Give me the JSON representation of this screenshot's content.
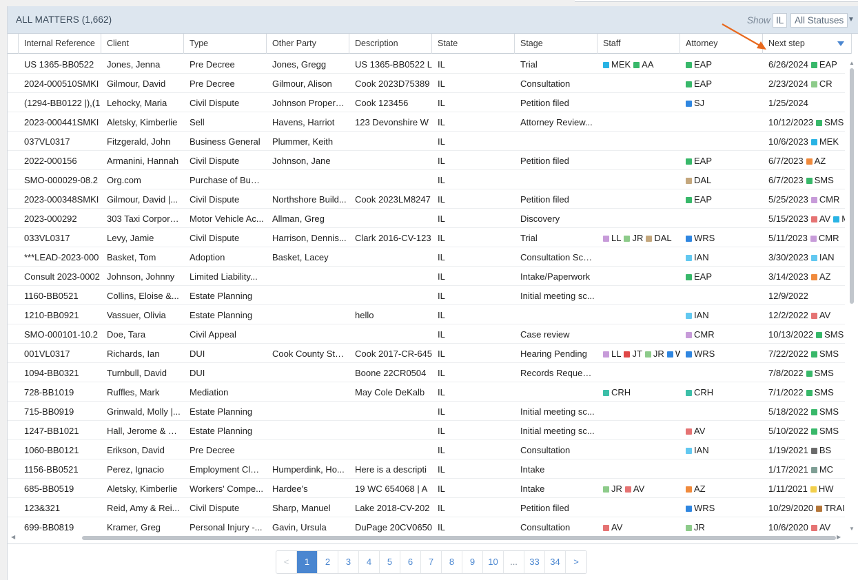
{
  "header": {
    "title": "ALL MATTERS (1,662)",
    "show_label": "Show",
    "state_filter": "IL",
    "status_filter": "All Statuses"
  },
  "columns": [
    "Internal Reference",
    "Client",
    "Type",
    "Other Party",
    "Description",
    "State",
    "Stage",
    "Staff",
    "Attorney",
    "Next step"
  ],
  "colors": {
    "accent": "#4a86d0",
    "annotation_arrow": "#e8691e"
  },
  "tag_colors": {
    "MEK": "#29b3e4",
    "AA": "#38b86a",
    "EAP": "#38b86a",
    "CR": "#8dcb8a",
    "SJ": "#2f86e0",
    "SMS": "#38b86a",
    "AZ": "#f08a3c",
    "DAL": "#c4a77d",
    "CMR": "#c79bd9",
    "AV": "#e57373",
    "LL": "#c79bd9",
    "JR": "#8dcb8a",
    "WRS": "#2f86e0",
    "IAN": "#62c8f0",
    "JT": "#e04848",
    "W": "#2f86e0",
    "CRH": "#3cbfa8",
    "BS": "#6b6b6b",
    "MC": "#7f9f95",
    "HW": "#f2cf4a",
    "TRAI": "#b5773a"
  },
  "rows": [
    {
      "ref": "US 1365-BB0522",
      "client": "Jones, Jenna",
      "type": "Pre Decree",
      "other": "Jones, Gregg",
      "desc": "US 1365-BB0522 L",
      "state": "IL",
      "stage": "Trial",
      "staff": [
        "MEK",
        "AA"
      ],
      "attorney": [
        "EAP"
      ],
      "next_date": "6/26/2024",
      "next_tag": [
        "EAP"
      ]
    },
    {
      "ref": "2024-000510SMKI",
      "client": "Gilmour, David",
      "type": "Pre Decree",
      "other": "Gilmour, Alison",
      "desc": "Cook 2023D75389",
      "state": "IL",
      "stage": "Consultation",
      "staff": [],
      "attorney": [
        "EAP"
      ],
      "next_date": "2/23/2024",
      "next_tag": [
        "CR"
      ]
    },
    {
      "ref": "(1294-BB0122 |),(1",
      "client": "Lehocky, Maria",
      "type": "Civil Dispute",
      "other": "Johnson Properti...",
      "desc": "Cook 123456",
      "state": "IL",
      "stage": "Petition filed",
      "staff": [],
      "attorney": [
        "SJ"
      ],
      "next_date": "1/25/2024",
      "next_tag": []
    },
    {
      "ref": "2023-000441SMKI",
      "client": "Aletsky, Kimberlie",
      "type": "Sell",
      "other": "Havens, Harriot",
      "desc": "123 Devonshire W",
      "state": "IL",
      "stage": "Attorney Review...",
      "staff": [],
      "attorney": [],
      "next_date": "10/12/2023",
      "next_tag": [
        "SMS"
      ]
    },
    {
      "ref": "037VL0317",
      "client": "Fitzgerald, John",
      "type": "Business General",
      "other": "Plummer, Keith",
      "desc": "",
      "state": "IL",
      "stage": "",
      "staff": [],
      "attorney": [],
      "next_date": "10/6/2023",
      "next_tag": [
        "MEK"
      ]
    },
    {
      "ref": "2022-000156",
      "client": "Armanini, Hannah",
      "type": "Civil Dispute",
      "other": "Johnson, Jane",
      "desc": "",
      "state": "IL",
      "stage": "Petition filed",
      "staff": [],
      "attorney": [
        "EAP"
      ],
      "next_date": "6/7/2023",
      "next_tag": [
        "AZ"
      ]
    },
    {
      "ref": "SMO-000029-08.2",
      "client": "Org.com",
      "type": "Purchase of Busi...",
      "other": "",
      "desc": "",
      "state": "IL",
      "stage": "",
      "staff": [],
      "attorney": [
        "DAL"
      ],
      "next_date": "6/7/2023",
      "next_tag": [
        "SMS"
      ]
    },
    {
      "ref": "2023-000348SMKI",
      "client": "Gilmour, David |...",
      "type": "Civil Dispute",
      "other": "Northshore Build...",
      "desc": "Cook 2023LM8247",
      "state": "IL",
      "stage": "Petition filed",
      "staff": [],
      "attorney": [
        "EAP"
      ],
      "next_date": "5/25/2023",
      "next_tag": [
        "CMR"
      ]
    },
    {
      "ref": "2023-000292",
      "client": "303 Taxi Corpora...",
      "type": "Motor Vehicle Ac...",
      "other": "Allman, Greg",
      "desc": "",
      "state": "IL",
      "stage": "Discovery",
      "staff": [],
      "attorney": [],
      "next_date": "5/15/2023",
      "next_tag": [
        "AV",
        "MEK"
      ]
    },
    {
      "ref": "033VL0317",
      "client": "Levy, Jamie",
      "type": "Civil Dispute",
      "other": "Harrison, Dennis...",
      "desc": "Clark 2016-CV-123",
      "state": "IL",
      "stage": "Trial",
      "staff": [
        "LL",
        "JR",
        "DAL"
      ],
      "attorney": [
        "WRS"
      ],
      "next_date": "5/11/2023",
      "next_tag": [
        "CMR"
      ]
    },
    {
      "ref": "***LEAD-2023-000",
      "client": "Basket, Tom",
      "type": "Adoption",
      "other": "Basket, Lacey",
      "desc": "",
      "state": "IL",
      "stage": "Consultation Sch...",
      "staff": [],
      "attorney": [
        "IAN"
      ],
      "next_date": "3/30/2023",
      "next_tag": [
        "IAN"
      ]
    },
    {
      "ref": "Consult 2023-0002",
      "client": "Johnson, Johnny",
      "type": "Limited Liability...",
      "other": "",
      "desc": "",
      "state": "IL",
      "stage": "Intake/Paperwork",
      "staff": [],
      "attorney": [
        "EAP"
      ],
      "next_date": "3/14/2023",
      "next_tag": [
        "AZ"
      ]
    },
    {
      "ref": "1160-BB0521",
      "client": "Collins, Eloise &...",
      "type": "Estate Planning",
      "other": "",
      "desc": "",
      "state": "IL",
      "stage": "Initial meeting sc...",
      "staff": [],
      "attorney": [],
      "next_date": "12/9/2022",
      "next_tag": []
    },
    {
      "ref": "1210-BB0921",
      "client": "Vassuer, Olivia",
      "type": "Estate Planning",
      "other": "",
      "desc": "hello",
      "state": "IL",
      "stage": "",
      "staff": [],
      "attorney": [
        "IAN"
      ],
      "next_date": "12/2/2022",
      "next_tag": [
        "AV"
      ]
    },
    {
      "ref": "SMO-000101-10.2",
      "client": "Doe, Tara",
      "type": "Civil Appeal",
      "other": "",
      "desc": "",
      "state": "IL",
      "stage": "Case review",
      "staff": [],
      "attorney": [
        "CMR"
      ],
      "next_date": "10/13/2022",
      "next_tag": [
        "SMS"
      ]
    },
    {
      "ref": "001VL0317",
      "client": "Richards, Ian",
      "type": "DUI",
      "other": "Cook County Sta...",
      "desc": "Cook 2017-CR-645",
      "state": "IL",
      "stage": "Hearing Pending",
      "staff": [
        "LL",
        "JT",
        "JR",
        "W"
      ],
      "attorney": [
        "WRS"
      ],
      "next_date": "7/22/2022",
      "next_tag": [
        "SMS"
      ]
    },
    {
      "ref": "1094-BB0321",
      "client": "Turnbull, David",
      "type": "DUI",
      "other": "",
      "desc": "Boone 22CR0504",
      "state": "IL",
      "stage": "Records Request...",
      "staff": [],
      "attorney": [],
      "next_date": "7/8/2022",
      "next_tag": [
        "SMS"
      ]
    },
    {
      "ref": "728-BB1019",
      "client": "Ruffles, Mark",
      "type": "Mediation",
      "other": "",
      "desc": "May Cole DeKalb",
      "state": "IL",
      "stage": "",
      "staff": [
        "CRH"
      ],
      "attorney": [
        "CRH"
      ],
      "next_date": "7/1/2022",
      "next_tag": [
        "SMS"
      ]
    },
    {
      "ref": "715-BB0919",
      "client": "Grinwald, Molly |...",
      "type": "Estate Planning",
      "other": "",
      "desc": "",
      "state": "IL",
      "stage": "Initial meeting sc...",
      "staff": [],
      "attorney": [],
      "next_date": "5/18/2022",
      "next_tag": [
        "SMS"
      ]
    },
    {
      "ref": "1247-BB1021",
      "client": "Hall, Jerome & H...",
      "type": "Estate Planning",
      "other": "",
      "desc": "",
      "state": "IL",
      "stage": "Initial meeting sc...",
      "staff": [],
      "attorney": [
        "AV"
      ],
      "next_date": "5/10/2022",
      "next_tag": [
        "SMS"
      ]
    },
    {
      "ref": "1060-BB0121",
      "client": "Erikson, David",
      "type": "Pre Decree",
      "other": "",
      "desc": "",
      "state": "IL",
      "stage": "Consultation",
      "staff": [],
      "attorney": [
        "IAN"
      ],
      "next_date": "1/19/2021",
      "next_tag": [
        "BS"
      ]
    },
    {
      "ref": "1156-BB0521",
      "client": "Perez, Ignacio",
      "type": "Employment Claim",
      "other": "Humperdink, Ho...",
      "desc": "Here is a descripti",
      "state": "IL",
      "stage": "Intake",
      "staff": [],
      "attorney": [],
      "next_date": "1/17/2021",
      "next_tag": [
        "MC"
      ]
    },
    {
      "ref": "685-BB0519",
      "client": "Aletsky, Kimberlie",
      "type": "Workers' Compe...",
      "other": "Hardee's",
      "desc": "19 WC 654068 | A",
      "state": "IL",
      "stage": "Intake",
      "staff": [
        "JR",
        "AV"
      ],
      "attorney": [
        "AZ"
      ],
      "next_date": "1/11/2021",
      "next_tag": [
        "HW"
      ]
    },
    {
      "ref": "123&321",
      "client": "Reid, Amy & Rei...",
      "type": "Civil Dispute",
      "other": "Sharp, Manuel",
      "desc": "Lake 2018-CV-202",
      "state": "IL",
      "stage": "Petition filed",
      "staff": [],
      "attorney": [
        "WRS"
      ],
      "next_date": "10/29/2020",
      "next_tag": [
        "TRAI"
      ]
    },
    {
      "ref": "699-BB0819",
      "client": "Kramer, Greg",
      "type": "Personal Injury -...",
      "other": "Gavin, Ursula",
      "desc": "DuPage 20CV0650",
      "state": "IL",
      "stage": "Consultation",
      "staff": [
        "AV"
      ],
      "attorney": [
        "JR"
      ],
      "next_date": "10/6/2020",
      "next_tag": [
        "AV"
      ]
    }
  ],
  "pagination": {
    "prev": "<",
    "pages": [
      "1",
      "2",
      "3",
      "4",
      "5",
      "6",
      "7",
      "8",
      "9",
      "10",
      "...",
      "33",
      "34"
    ],
    "next": ">",
    "current": "1"
  }
}
